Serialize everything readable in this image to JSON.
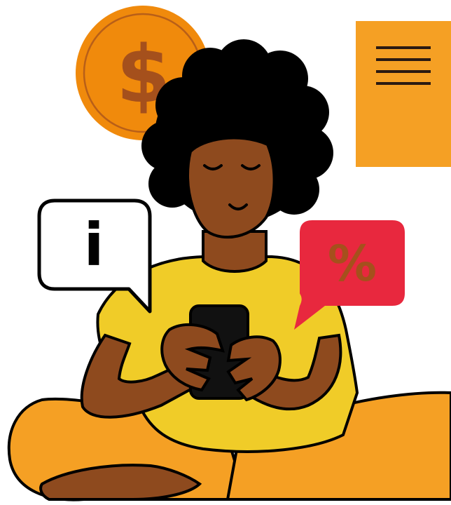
{
  "illustration": {
    "coin_symbol": "$",
    "info_symbol": "i",
    "percent_symbol": "%"
  },
  "colors": {
    "coin": "#F08A0C",
    "coin_symbol": "#A5501C",
    "document": "#F5A024",
    "document_lines": "#2A1A12",
    "info_bubble": "#FFFFFF",
    "percent_bubble": "#E8283E",
    "percent_symbol": "#A5501C",
    "hair": "#000000",
    "skin": "#8E4A1E",
    "shirt": "#F0CC28",
    "pants": "#F5A024",
    "phone": "#111111",
    "outline": "#000000"
  },
  "icons": [
    "coin-dollar-icon",
    "document-menu-icon",
    "info-speech-bubble-icon",
    "percent-speech-bubble-icon",
    "smartphone-icon"
  ]
}
